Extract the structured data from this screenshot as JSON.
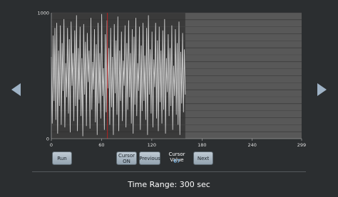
{
  "chart_data": {
    "type": "line",
    "xlim": [
      0,
      299
    ],
    "ylim": [
      0,
      1000
    ],
    "x_ticks": [
      "0",
      "60",
      "120",
      "180",
      "240",
      "299"
    ],
    "y_ticks": [
      "0",
      "1000"
    ],
    "grid": true,
    "filled_until": 160,
    "cursor_x": 67,
    "series": [
      {
        "values": [
          650,
          120,
          820,
          300,
          880,
          150,
          920,
          40,
          700,
          260,
          900,
          110,
          760,
          380,
          950,
          90,
          600,
          330,
          880,
          200,
          790,
          50,
          930,
          420,
          680,
          140,
          860,
          260,
          980,
          60,
          720,
          310,
          890,
          180,
          640,
          20,
          910,
          350,
          770,
          100,
          840,
          450,
          700,
          80,
          960,
          230,
          610,
          390,
          870,
          130,
          750,
          30,
          920,
          280,
          680,
          160,
          990,
          340,
          560,
          70,
          830,
          210,
          940,
          400,
          720,
          110,
          880,
          250,
          650,
          30,
          910,
          360,
          780,
          190,
          970,
          60,
          700,
          300,
          850,
          140,
          620,
          420,
          900,
          90,
          760,
          230,
          940,
          330,
          680,
          120,
          870,
          40,
          810,
          270,
          960,
          180,
          600,
          380,
          890,
          70,
          740,
          220,
          920,
          300,
          660,
          150,
          880,
          30,
          980,
          350,
          710,
          200,
          850,
          90,
          630,
          410,
          920,
          160,
          780,
          60,
          890,
          290,
          700,
          120,
          860,
          230,
          950,
          40,
          640,
          370,
          830,
          180,
          720,
          260,
          900,
          70,
          580,
          340,
          870,
          190,
          760,
          110,
          930,
          30,
          690,
          280,
          840,
          210,
          710,
          350
        ],
        "color": "#d2d2d2"
      }
    ]
  },
  "controls": {
    "run_label": "Run",
    "cursor_on_line1": "Cursor",
    "cursor_on_line2": "ON",
    "previous_label": "Previous",
    "cursor_value_label": "Cursor Value",
    "cursor_value": "67",
    "next_label": "Next"
  },
  "footer": {
    "time_range": "Time Range: 300 sec"
  },
  "icons": {
    "left": "nav-left-arrow-icon",
    "right": "nav-right-arrow-icon"
  },
  "colors": {
    "background": "#2b2e30",
    "plot_bg": "#3a3a3a",
    "plot_empty_bg": "#585858",
    "line": "#d2d2d2",
    "cursor": "#b22222",
    "accent": "#7fc6ff"
  }
}
